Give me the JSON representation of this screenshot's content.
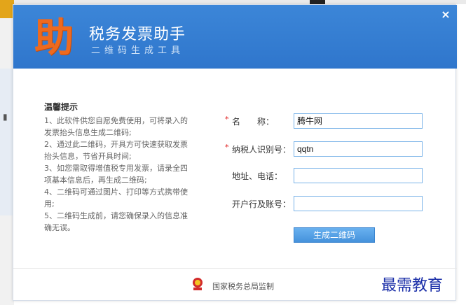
{
  "header": {
    "logo_char": "助",
    "title": "税务发票助手",
    "subtitle": "二维码生成工具",
    "close_glyph": "×"
  },
  "tips": {
    "title": "温馨提示",
    "items": [
      "1、此软件供您自愿免费使用，可将录入的发票抬头信息生成二维码;",
      "2、通过此二维码，开具方可快速获取发票抬头信息，节省开具时间;",
      "3、如您需取得增值税专用发票，请录全四项基本信息后，再生成二维码;",
      "4、二维码可通过图片、打印等方式携带使用;",
      "5、二维码生成前，请您确保录入的信息准确无误。"
    ]
  },
  "form": {
    "required_mark": "*",
    "name_label": "名　　称：",
    "name_value": "腾牛网",
    "taxid_label": "纳税人识别号：",
    "taxid_value": "qqtn",
    "address_label": "地址、电话：",
    "address_value": "",
    "bank_label": "开户行及账号：",
    "bank_value": "",
    "submit_label": "生成二维码"
  },
  "footer": {
    "supervisor": "国家税务总局监制"
  },
  "watermark": "最需教育",
  "colors": {
    "header_blue": "#3580d4",
    "logo_orange": "#ee6a1e",
    "button_blue": "#4592dc",
    "required_red": "#e02020"
  }
}
